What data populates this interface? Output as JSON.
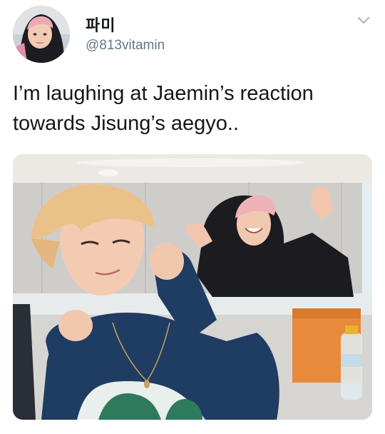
{
  "tweet": {
    "author": {
      "display_name": "파미",
      "handle": "@813vitamin",
      "avatar_icon": "profile-photo"
    },
    "menu_icon": "chevron-down-icon",
    "text": "I’m laughing at Jaemin’s reaction towards Jisung’s aegyo..",
    "media": {
      "type": "photo"
    }
  },
  "colors": {
    "text_primary": "#14171a",
    "text_secondary": "#657786",
    "chevron": "#aab8c2",
    "background": "#ffffff"
  }
}
